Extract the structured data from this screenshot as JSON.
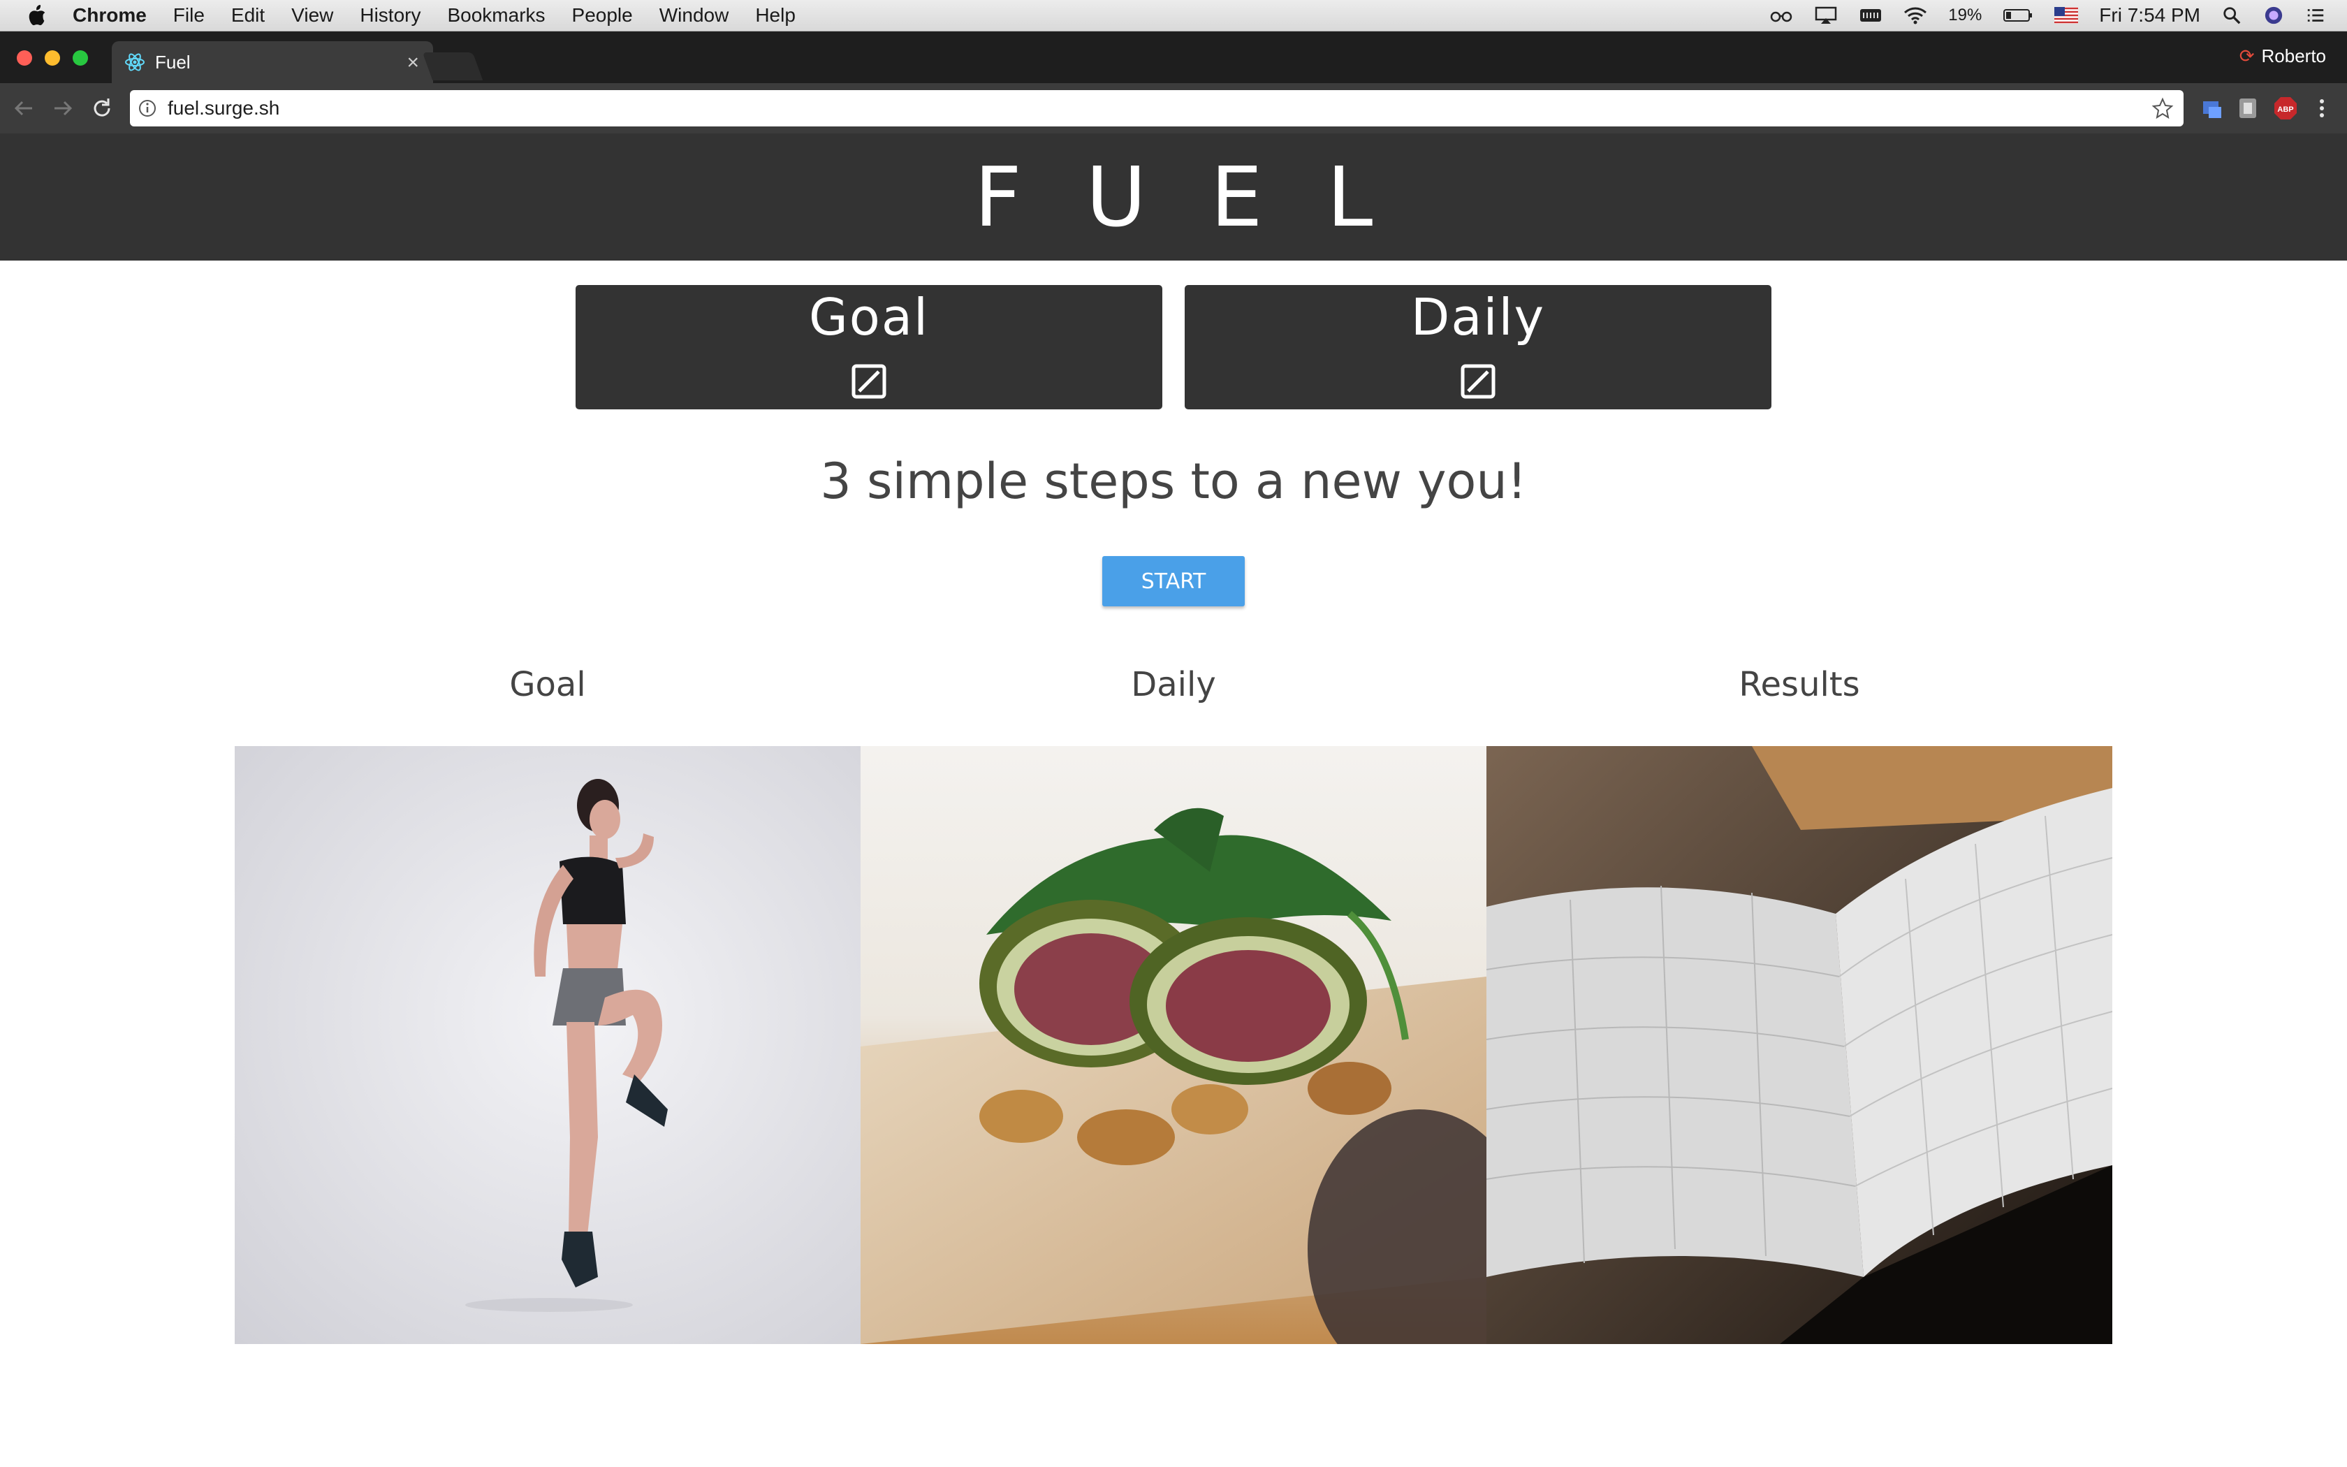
{
  "menubar": {
    "app": "Chrome",
    "menus": [
      "File",
      "Edit",
      "View",
      "History",
      "Bookmarks",
      "People",
      "Window",
      "Help"
    ],
    "battery": "19%",
    "clock": "Fri 7:54 PM"
  },
  "browser": {
    "tab_title": "Fuel",
    "tab_close": "×",
    "profile_name": "Roberto",
    "url": "fuel.surge.sh"
  },
  "page": {
    "brand": "FUEL",
    "cards": [
      {
        "title": "Goal",
        "icon": "edit-square-icon"
      },
      {
        "title": "Daily",
        "icon": "edit-square-icon"
      }
    ],
    "tagline": "3 simple steps to a new you!",
    "start_label": "START",
    "steps": [
      {
        "label": "Goal",
        "image": "athlete-jumping-photo"
      },
      {
        "label": "Daily",
        "image": "figs-and-walnuts-photo"
      },
      {
        "label": "Results",
        "image": "open-planner-calendar-photo"
      }
    ]
  },
  "colors": {
    "header_bg": "#333333",
    "accent": "#4aa0e8",
    "text": "#444444"
  }
}
